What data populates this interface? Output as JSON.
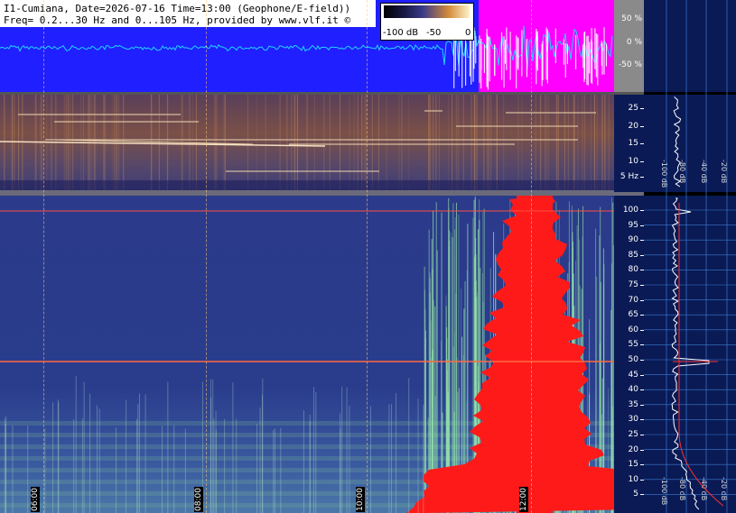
{
  "header": {
    "line1": "I1-Cumiana, Date=2026-07-16 Time=13:00 (Geophone/E-field))",
    "line2": "Freq= 0.2...30 Hz and 0...105 Hz, provided by www.vlf.it ©"
  },
  "colorbar": {
    "labels": [
      "-100 dB",
      "-50",
      "0"
    ]
  },
  "waveform_scale": [
    "50 %",
    "0 %",
    "-50 %"
  ],
  "low_axis": [
    "25",
    "20",
    "15",
    "10",
    "5 Hz"
  ],
  "high_axis": [
    "100",
    "95",
    "90",
    "85",
    "80",
    "75",
    "70",
    "65",
    "60",
    "55",
    "50",
    "45",
    "40",
    "35",
    "30",
    "25",
    "20",
    "15",
    "10",
    "5"
  ],
  "right_low_labels": [
    "-100 dB",
    "-80 dB",
    "-40 dB",
    "-20 dB"
  ],
  "right_high_labels": [
    "-100 dB",
    "-80 dB",
    "-40 dB",
    "-20 dB"
  ],
  "time_labels": [
    "06:00",
    "08:00",
    "10:00",
    "12:00"
  ],
  "colors": {
    "wave_bg": "#1f1fff",
    "wave_mag": "#ff00ff",
    "wave_trace": "#22d4ff",
    "hot": "#ff1a1a",
    "axis_bg": "#0b1a55"
  }
}
